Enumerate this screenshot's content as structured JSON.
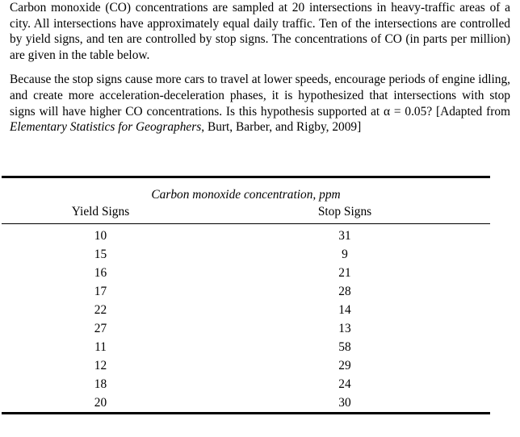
{
  "document": {
    "paragraphs": [
      {
        "id": "problem-statement",
        "runs": [
          {
            "text": "Carbon monoxide (CO) concentrations are sampled at 20 intersections in heavy-traffic areas of a city. All intersections have approximately equal daily traffic. Ten of the intersections are controlled by yield signs, and ten are controlled by stop signs. The concentrations of CO (in parts per million) are given in the table below.",
            "style": "normal"
          }
        ]
      },
      {
        "id": "hypothesis-statement",
        "runs": [
          {
            "text": "Because the stop signs cause more cars to travel at lower speeds, encourage periods of engine idling, and create more acceleration-deceleration phases, it is hypothesized that intersections with stop signs will have higher CO concentrations. Is this hypothesis supported at α = 0.05? [Adapted from ",
            "style": "normal"
          },
          {
            "text": "Elementary Statistics for Geographers",
            "style": "italic"
          },
          {
            "text": ", Burt, Barber, and Rigby, 2009]",
            "style": "normal"
          }
        ]
      }
    ]
  },
  "table": {
    "caption": "Carbon monoxide concentration, ppm",
    "columns": [
      "Yield Signs",
      "Stop Signs"
    ],
    "rows": [
      [
        "10",
        "31"
      ],
      [
        "15",
        "9"
      ],
      [
        "16",
        "21"
      ],
      [
        "17",
        "28"
      ],
      [
        "22",
        "14"
      ],
      [
        "27",
        "13"
      ],
      [
        "11",
        "58"
      ],
      [
        "12",
        "29"
      ],
      [
        "18",
        "24"
      ],
      [
        "20",
        "30"
      ]
    ]
  },
  "chart_data": {
    "type": "table",
    "title": "Carbon monoxide concentration, ppm",
    "categories": [
      "Yield Signs",
      "Stop Signs"
    ],
    "series": [
      {
        "name": "Yield Signs",
        "values": [
          10,
          15,
          16,
          17,
          22,
          27,
          11,
          12,
          18,
          20
        ]
      },
      {
        "name": "Stop Signs",
        "values": [
          31,
          9,
          21,
          28,
          14,
          13,
          58,
          29,
          24,
          30
        ]
      }
    ],
    "xlabel": "",
    "ylabel": "ppm",
    "n_per_group": 10,
    "units": "parts per million (ppm)"
  }
}
